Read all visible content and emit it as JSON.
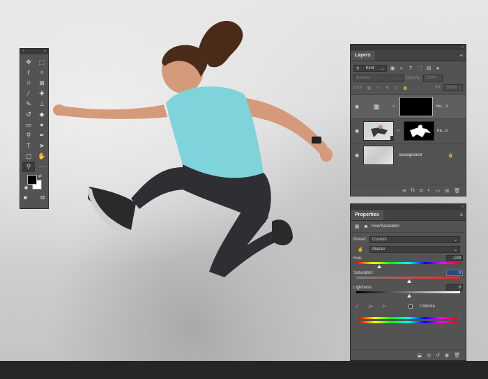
{
  "tools_panel": {
    "close_glyph": "×",
    "collapse_glyph": "«",
    "tools": [
      {
        "icon": "move-tool-icon",
        "glyph": "✥"
      },
      {
        "icon": "marquee-tool-icon",
        "glyph": "⬚"
      },
      {
        "icon": "lasso-tool-icon",
        "glyph": "ℓ"
      },
      {
        "icon": "magic-wand-tool-icon",
        "glyph": "✧"
      },
      {
        "icon": "crop-tool-icon",
        "glyph": "⌗"
      },
      {
        "icon": "frame-tool-icon",
        "glyph": "⊠"
      },
      {
        "icon": "eyedropper-tool-icon",
        "glyph": "∕"
      },
      {
        "icon": "healing-brush-tool-icon",
        "glyph": "✚"
      },
      {
        "icon": "brush-tool-icon",
        "glyph": "✎"
      },
      {
        "icon": "clone-stamp-tool-icon",
        "glyph": "⊥"
      },
      {
        "icon": "history-brush-tool-icon",
        "glyph": "↺"
      },
      {
        "icon": "eraser-tool-icon",
        "glyph": "◆"
      },
      {
        "icon": "gradient-tool-icon",
        "glyph": "▭"
      },
      {
        "icon": "blur-tool-icon",
        "glyph": "●"
      },
      {
        "icon": "dodge-tool-icon",
        "glyph": "⚲"
      },
      {
        "icon": "pen-tool-icon",
        "glyph": "✒"
      },
      {
        "icon": "type-tool-icon",
        "glyph": "T"
      },
      {
        "icon": "path-selection-tool-icon",
        "glyph": "➤"
      },
      {
        "icon": "rectangle-tool-icon",
        "glyph": "▢"
      },
      {
        "icon": "hand-tool-icon",
        "glyph": "✋"
      },
      {
        "icon": "zoom-tool-icon",
        "glyph": "⚲"
      },
      {
        "icon": "more-tools-icon",
        "glyph": "···"
      }
    ],
    "foreground_color": "#000000",
    "background_color": "#ffffff",
    "quick_mask_glyph": "◙",
    "screen_mode_glyph": "⧉"
  },
  "layers_panel": {
    "tab_label": "Layers",
    "menu_glyph": "≡",
    "filter_kind": "Kind",
    "blend_mode": "Normal",
    "opacity_label": "Opacity:",
    "opacity_value": "100%",
    "lock_label": "Lock:",
    "fill_label": "Fill:",
    "fill_value": "100%",
    "layers": [
      {
        "name": "Hu... 1",
        "type": "adjustment",
        "selected": true
      },
      {
        "name": "ha...V",
        "type": "photo",
        "selected": false
      },
      {
        "name": "Background",
        "type": "background",
        "selected": false,
        "locked": true
      }
    ],
    "footer_icons": [
      "link-layers-icon",
      "fx-icon",
      "add-mask-icon",
      "new-adjustment-icon",
      "new-group-icon",
      "new-layer-icon",
      "delete-layer-icon"
    ],
    "footer_glyphs": [
      "⊖",
      "fx",
      "◘",
      "◐",
      "▭",
      "⊞",
      "🗑"
    ]
  },
  "properties_panel": {
    "tab_label": "Properties",
    "menu_glyph": "≡",
    "adjustment_title": "Hue/Saturation",
    "preset_label": "Preset:",
    "preset_value": "Custom",
    "channel_value": "Master",
    "hue_label": "Hue:",
    "hue_value": "-100",
    "saturation_label": "Saturation:",
    "saturation_value": "0",
    "lightness_label": "Lightness:",
    "lightness_value": "0",
    "hue_level": 0.22,
    "saturation_level": 0.5,
    "lightness_level": 0.5,
    "colorize_label": "Colorize",
    "colorize_checked": false,
    "footer_icons": [
      "clip-to-layer-icon",
      "view-previous-icon",
      "reset-icon",
      "visibility-icon",
      "delete-icon"
    ],
    "footer_glyphs": [
      "⬓",
      "◎",
      "↺",
      "◉",
      "🗑"
    ]
  }
}
